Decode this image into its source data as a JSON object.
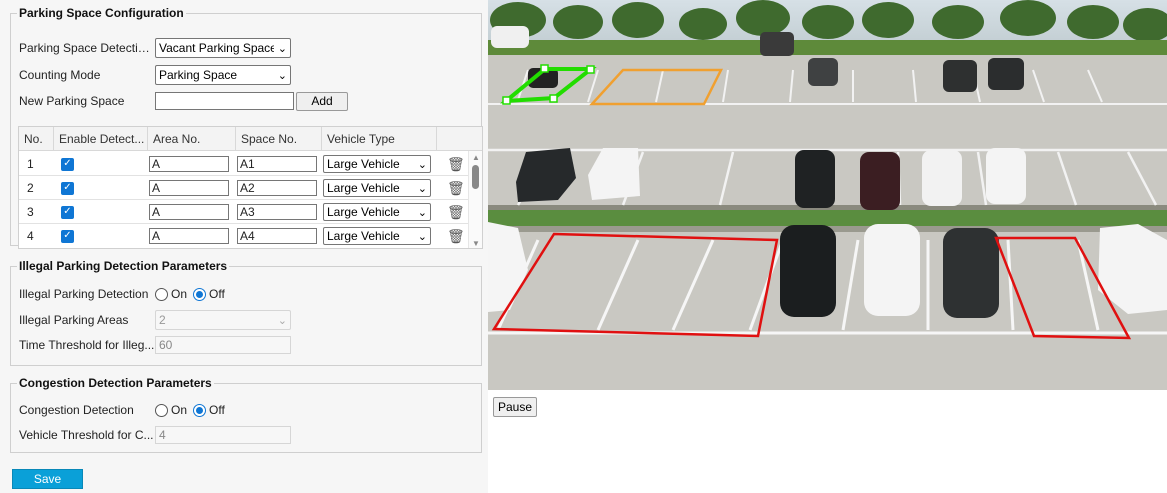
{
  "parking": {
    "legend": "Parking Space Configuration",
    "detection_label": "Parking Space Detection...",
    "detection_value": "Vacant Parking Space",
    "counting_label": "Counting Mode",
    "counting_value": "Parking Space",
    "new_space_label": "New Parking Space",
    "new_space_value": "",
    "add_label": "Add",
    "table": {
      "headers": [
        "No.",
        "Enable Detect...",
        "Area No.",
        "Space No.",
        "Vehicle Type"
      ],
      "rows": [
        {
          "no": "1",
          "enabled": true,
          "area": "A",
          "space": "A1",
          "vehicle": "Large Vehicle"
        },
        {
          "no": "2",
          "enabled": true,
          "area": "A",
          "space": "A2",
          "vehicle": "Large Vehicle"
        },
        {
          "no": "3",
          "enabled": true,
          "area": "A",
          "space": "A3",
          "vehicle": "Large Vehicle"
        },
        {
          "no": "4",
          "enabled": true,
          "area": "A",
          "space": "A4",
          "vehicle": "Large Vehicle"
        }
      ]
    }
  },
  "illegal": {
    "legend": "Illegal Parking Detection Parameters",
    "detection_label": "Illegal Parking Detection",
    "on_label": "On",
    "off_label": "Off",
    "selected": "Off",
    "areas_label": "Illegal Parking Areas",
    "areas_value": "2",
    "time_label": "Time Threshold for Illeg...",
    "time_value": "60"
  },
  "congestion": {
    "legend": "Congestion Detection Parameters",
    "detection_label": "Congestion Detection",
    "on_label": "On",
    "off_label": "Off",
    "selected": "Off",
    "vehicle_label": "Vehicle Threshold for C...",
    "vehicle_value": "4"
  },
  "actions": {
    "save_label": "Save",
    "pause_label": "Pause"
  },
  "colors": {
    "accent": "#0f76d4",
    "save_button": "#0aa0d8",
    "region_green": "#22dd00",
    "region_orange": "#f0a030",
    "region_red": "#e01010"
  },
  "icons": {
    "checkbox": "checkmark",
    "delete": "trash-can",
    "dropdown": "chevron-down"
  }
}
